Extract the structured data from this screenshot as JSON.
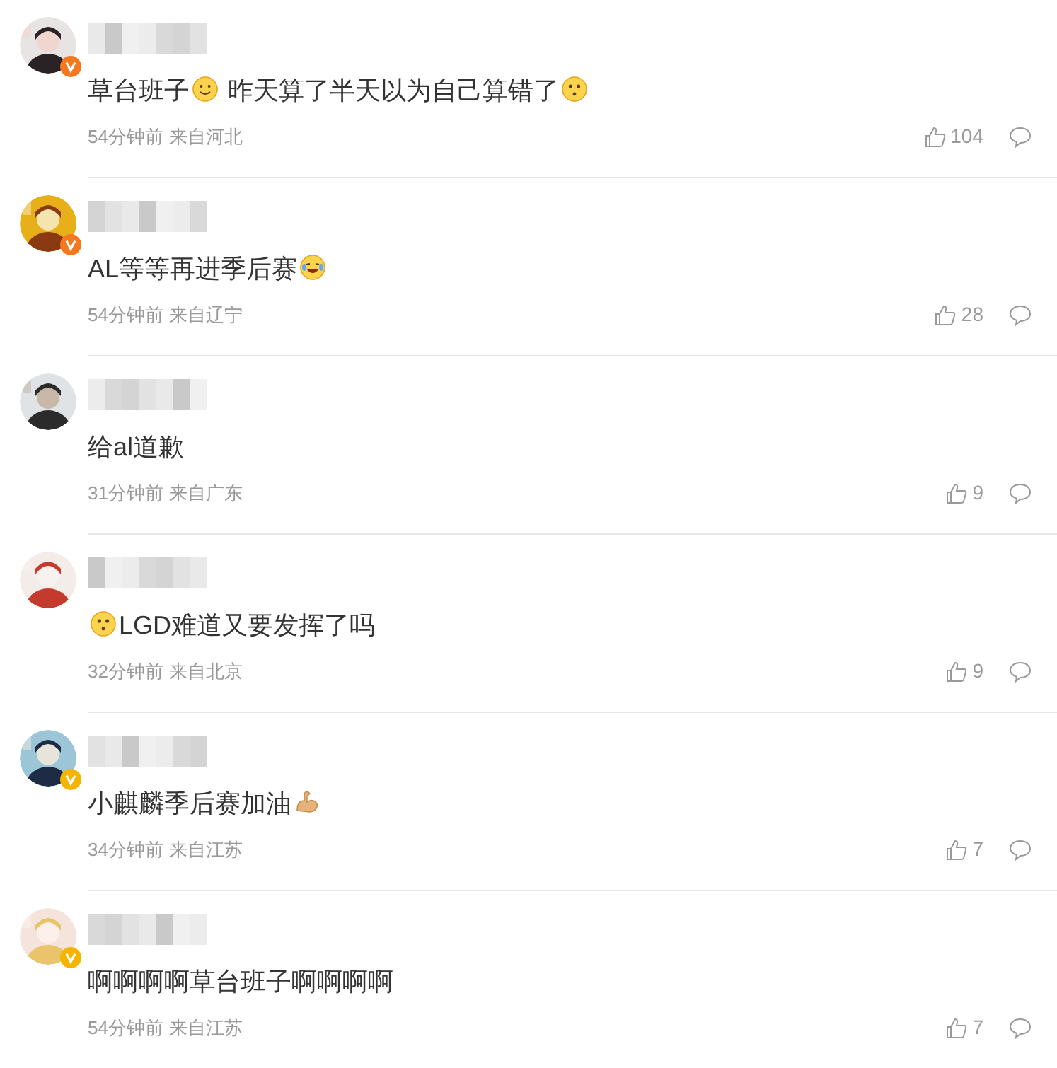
{
  "comments": [
    {
      "badge": {
        "color": "#f5781e"
      },
      "content": [
        {
          "kind": "text",
          "text": "草台班子"
        },
        {
          "kind": "smile"
        },
        {
          "kind": "text",
          "text": " 昨天算了半天以为自己算错了"
        },
        {
          "kind": "puzzled"
        }
      ],
      "time": "54分钟前",
      "location": "来自河北",
      "likes": "104"
    },
    {
      "badge": {
        "color": "#f5781e"
      },
      "content": [
        {
          "kind": "text",
          "text": "AL等等再进季后赛"
        },
        {
          "kind": "laugh"
        }
      ],
      "time": "54分钟前",
      "location": "来自辽宁",
      "likes": "28"
    },
    {
      "content": [
        {
          "kind": "text",
          "text": "给al道歉"
        }
      ],
      "time": "31分钟前",
      "location": "来自广东",
      "likes": "9"
    },
    {
      "content": [
        {
          "kind": "puzzled"
        },
        {
          "kind": "text",
          "text": "LGD难道又要发挥了吗"
        }
      ],
      "time": "32分钟前",
      "location": "来自北京",
      "likes": "9"
    },
    {
      "badge": {
        "color": "#f4b400"
      },
      "content": [
        {
          "kind": "text",
          "text": "小麒麟季后赛加油"
        },
        {
          "kind": "muscle"
        }
      ],
      "time": "34分钟前",
      "location": "来自江苏",
      "likes": "7"
    },
    {
      "badge": {
        "color": "#f4b400"
      },
      "content": [
        {
          "kind": "text",
          "text": "啊啊啊啊草台班子啊啊啊啊"
        }
      ],
      "time": "54分钟前",
      "location": "来自江苏",
      "likes": "7"
    }
  ]
}
